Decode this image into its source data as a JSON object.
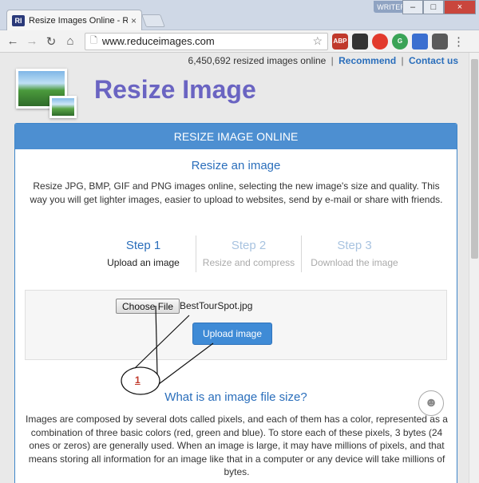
{
  "browser": {
    "tab_favicon": "RI",
    "tab_title": "Resize Images Online - Re",
    "tab_close": "×",
    "profile_label": "WRITER",
    "window_buttons": {
      "minimize": "–",
      "maximize": "□",
      "close": "×"
    },
    "nav": {
      "back": "←",
      "forward": "→",
      "reload": "↻",
      "home": "⌂"
    },
    "url": "www.reduceimages.com",
    "extensions": [
      {
        "name": "adblock-plus-icon",
        "label": "ABP"
      },
      {
        "name": "ghostery-icon",
        "label": ""
      },
      {
        "name": "opera-icon",
        "label": ""
      },
      {
        "name": "grammarly-icon",
        "label": "G"
      },
      {
        "name": "extension-icon",
        "label": ""
      },
      {
        "name": "pocket-icon",
        "label": ""
      }
    ],
    "menu": "⋮"
  },
  "page": {
    "stats_text": "6,450,692 resized images online",
    "recommend_link": "Recommend",
    "contact_link": "Contact us",
    "site_title": "Resize Image",
    "panel_header": "RESIZE IMAGE ONLINE",
    "section_title": "Resize an image",
    "intro": "Resize JPG, BMP, GIF and PNG images online, selecting the new image's size and quality. This way you will get lighter images, easier to upload to websites, send by e-mail or share with friends.",
    "steps": [
      {
        "title": "Step 1",
        "subtitle": "Upload an image"
      },
      {
        "title": "Step 2",
        "subtitle": "Resize and compress"
      },
      {
        "title": "Step 3",
        "subtitle": "Download the image"
      }
    ],
    "upload": {
      "choose_label": "Choose File",
      "filename": "BestTourSpot.jpg",
      "upload_label": "Upload image"
    },
    "annotation_label": "1",
    "question_title": "What is an image file size?",
    "body_text": "Images are composed by several dots called pixels, and each of them has a color, represented as a combination of three basic colors (red, green and blue). To store each of these pixels, 3 bytes (24 ones or zeros) are generally used. When an image is large, it may have millions of pixels, and that means storing all information for an image like that in a computer or any device will take millions of bytes."
  },
  "colors": {
    "site_title": "#6a64c2",
    "panel_header": "#4d8fd1",
    "link": "#2a6ebb",
    "upload_button": "#3f8bd6",
    "annotation": "#c0392b"
  }
}
